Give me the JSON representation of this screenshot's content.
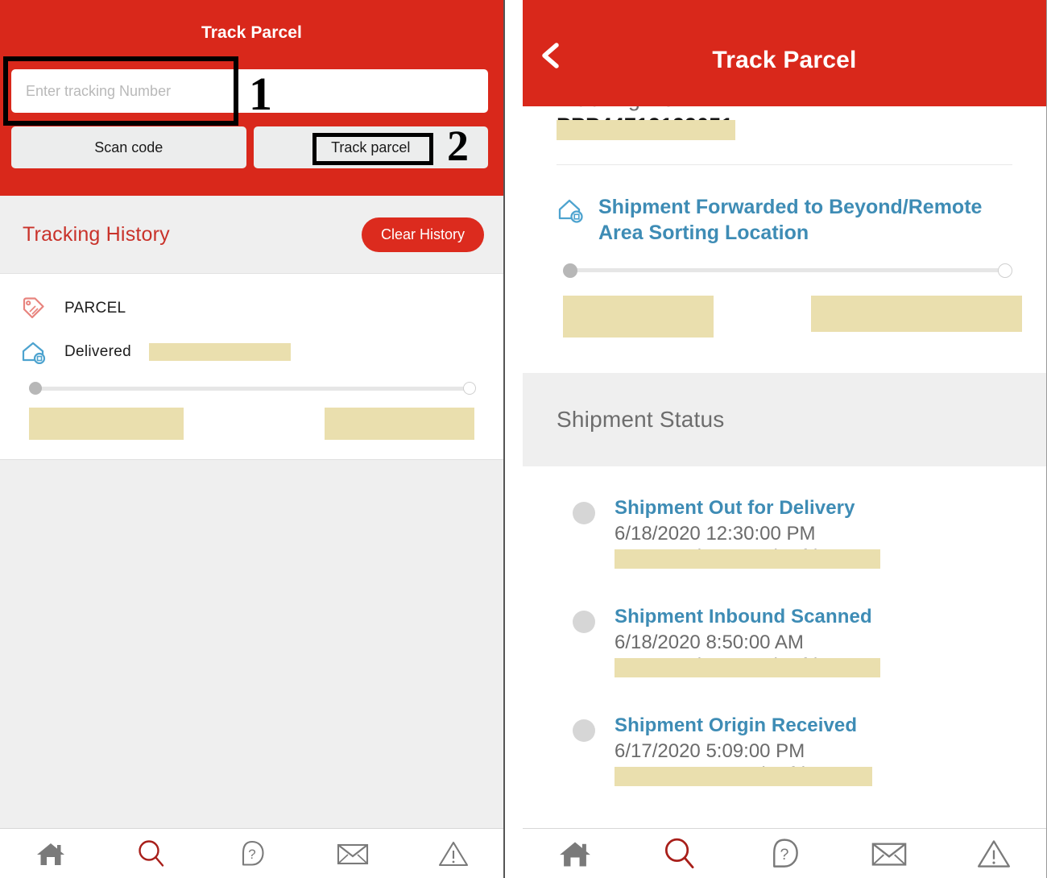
{
  "left_screen": {
    "header": {
      "title": "Track Parcel",
      "tracking_input_placeholder": "Enter tracking Number",
      "tracking_input_value": "",
      "scan_button": "Scan code",
      "track_button": "Track parcel"
    },
    "annotations": [
      {
        "number": "1",
        "target": "tracking-number-input"
      },
      {
        "number": "2",
        "target": "track-parcel-button"
      }
    ],
    "history": {
      "title": "Tracking History",
      "clear_button": "Clear History",
      "entry": {
        "type_icon": "parcel-tag-icon",
        "type_label": "PARCEL",
        "status_icon": "delivered-house-icon",
        "status_label": "Delivered",
        "status_redacted": "REDACTED",
        "progress_start_state": "filled",
        "progress_end_state": "empty",
        "redacted_left": "REDACTED",
        "redacted_right": "REDACTED"
      }
    },
    "bottom_nav": [
      {
        "icon": "home-icon",
        "active": false
      },
      {
        "icon": "search-icon",
        "active": true
      },
      {
        "icon": "help-icon",
        "active": false
      },
      {
        "icon": "mail-icon",
        "active": false
      },
      {
        "icon": "alert-icon",
        "active": false
      }
    ]
  },
  "right_screen": {
    "header": {
      "back_icon": "chevron-left-icon",
      "title": "Track Parcel"
    },
    "tracking_no": {
      "label": "Tracking No:",
      "value_redacted": "REDACTED"
    },
    "current_status": {
      "icon": "delivered-house-icon",
      "text": "Shipment Forwarded to Beyond/Remote Area Sorting Location",
      "progress_start_state": "filled",
      "progress_end_state": "empty",
      "redacted_left": "REDACTED",
      "redacted_right": "REDACTED"
    },
    "shipment_status": {
      "section_title": "Shipment Status",
      "events": [
        {
          "title": "Shipment Out for Delivery",
          "datetime": "6/18/2020 12:30:00 PM",
          "location_redacted": "REDACTED"
        },
        {
          "title": "Shipment Inbound Scanned",
          "datetime": "6/18/2020 8:50:00 AM",
          "location_redacted": "REDACTED"
        },
        {
          "title": "Shipment Origin Received",
          "datetime": "6/17/2020 5:09:00 PM",
          "location_redacted": "REDACTED"
        }
      ]
    },
    "bottom_nav": [
      {
        "icon": "home-icon",
        "active": false
      },
      {
        "icon": "search-icon",
        "active": true
      },
      {
        "icon": "help-icon",
        "active": false
      },
      {
        "icon": "mail-icon",
        "active": false
      },
      {
        "icon": "alert-icon",
        "active": false
      }
    ]
  },
  "colors": {
    "brand_red": "#d9281b",
    "link_blue": "#3e8cb5",
    "redaction_yellow": "#eadfae",
    "section_gray": "#efefef",
    "muted_text": "#6b6b6b"
  }
}
